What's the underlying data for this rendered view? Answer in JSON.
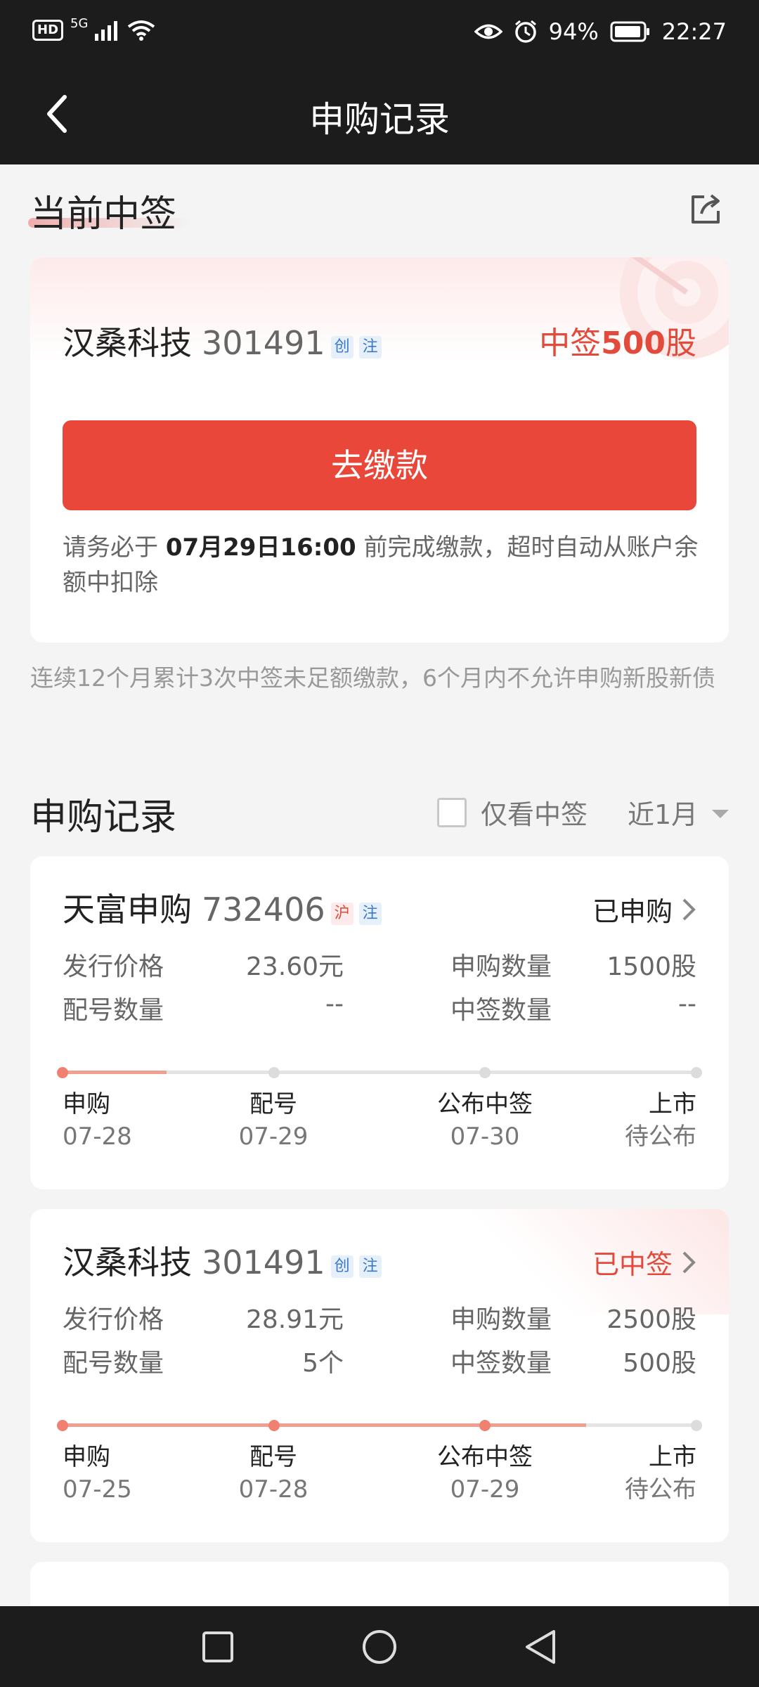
{
  "status_bar": {
    "left": [
      "HD",
      "5G"
    ],
    "battery": "94%",
    "time": "22:27",
    "icons": [
      "signal-icon",
      "wifi-icon",
      "eye-icon",
      "alarm-icon",
      "battery-icon"
    ]
  },
  "header": {
    "title": "申购记录",
    "back_icon": "chevron-left-icon"
  },
  "current": {
    "section_title": "当前中签",
    "share_icon": "share-icon",
    "stock_name": "汉桑科技",
    "stock_code": "301491",
    "tags": [
      "创",
      "注"
    ],
    "win_prefix": "中签",
    "win_amount": "500",
    "win_unit": "股",
    "pay_button": "去缴款",
    "note_prefix": "请务必于",
    "note_deadline": "07月29日16:00",
    "note_suffix": "前完成缴款，超时自动从账户余额中扣除"
  },
  "warning": "连续12个月累计3次中签未足额缴款，6个月内不允许申购新股新债",
  "records_section": {
    "title": "申购记录",
    "only_winning_label": "仅看中签",
    "period": "近1月"
  },
  "records": [
    {
      "name": "天富申购",
      "code": "732406",
      "tags": [
        "沪",
        "注"
      ],
      "status": "已申购",
      "issue_price_label": "发行价格",
      "issue_price": "23.60元",
      "apply_qty_label": "申购数量",
      "apply_qty": "1500股",
      "match_qty_label": "配号数量",
      "match_qty": "--",
      "win_qty_label": "中签数量",
      "win_qty": "--",
      "progress": 0.16,
      "steps": [
        {
          "label": "申购",
          "date": "07-28"
        },
        {
          "label": "配号",
          "date": "07-29"
        },
        {
          "label": "公布中签",
          "date": "07-30"
        },
        {
          "label": "上市",
          "date": "待公布"
        }
      ]
    },
    {
      "name": "汉桑科技",
      "code": "301491",
      "tags": [
        "创",
        "注"
      ],
      "status": "已中签",
      "issue_price_label": "发行价格",
      "issue_price": "28.91元",
      "apply_qty_label": "申购数量",
      "apply_qty": "2500股",
      "match_qty_label": "配号数量",
      "match_qty": "5个",
      "win_qty_label": "中签数量",
      "win_qty": "500股",
      "progress": 0.83,
      "steps": [
        {
          "label": "申购",
          "date": "07-25"
        },
        {
          "label": "配号",
          "date": "07-28"
        },
        {
          "label": "公布中签",
          "date": "07-29"
        },
        {
          "label": "上市",
          "date": "待公布"
        }
      ]
    }
  ],
  "colors": {
    "accent": "#e8473a",
    "header_bg": "#1c1c1c",
    "page_bg": "#f4f4f4"
  },
  "nav_icons": [
    "square-icon",
    "circle-home-icon",
    "triangle-back-icon"
  ]
}
